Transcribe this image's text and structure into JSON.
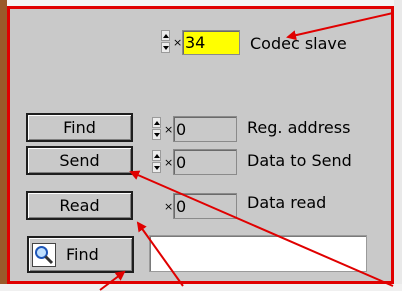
{
  "codec": {
    "value": "34",
    "label": "Codec slave",
    "x_mark": "×"
  },
  "reg": {
    "value": "0",
    "label": "Reg. address",
    "x_mark": "×"
  },
  "send": {
    "value": "0",
    "label": "Data to Send",
    "x_mark": "×"
  },
  "read": {
    "value": "0",
    "label": "Data read",
    "x_mark": "×"
  },
  "buttons": {
    "find": "Find",
    "send": "Send",
    "read": "Read",
    "search_find": "Find"
  },
  "search": {
    "value": ""
  },
  "colors": {
    "panel_border": "#e00000",
    "codec_field": "#ffff00",
    "arrows": "#e00000"
  },
  "icons": {
    "search": "magnifier-icon",
    "spinner": "up-down-spinner-icon"
  }
}
